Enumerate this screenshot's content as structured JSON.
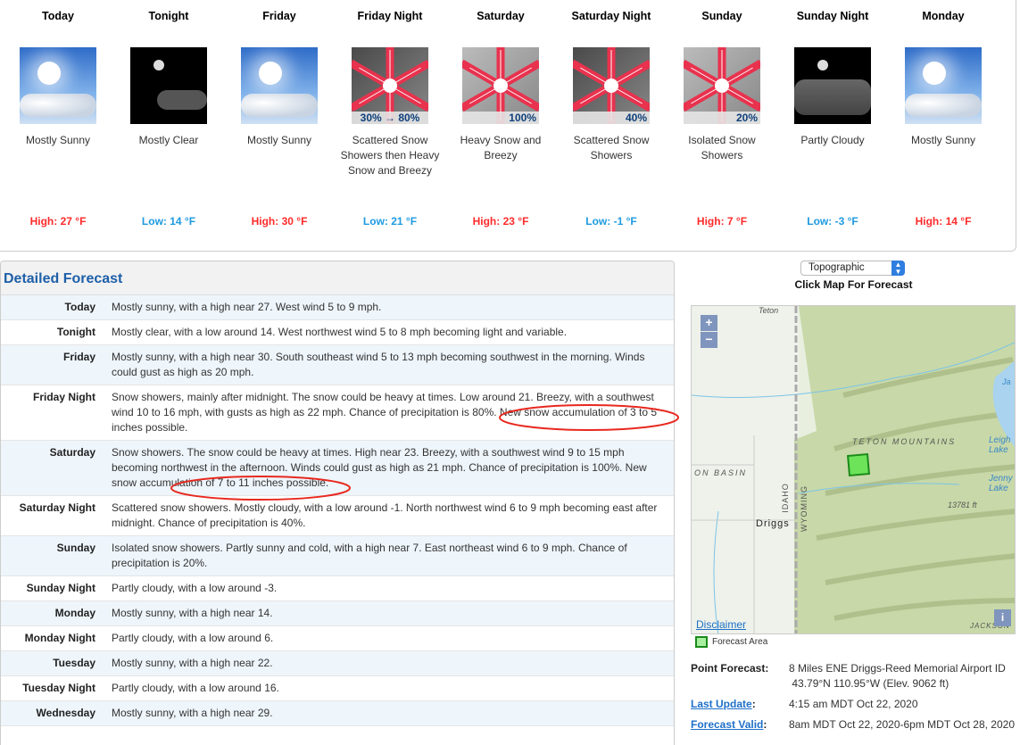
{
  "periods": [
    {
      "name": "Today",
      "icon": "sunny",
      "desc": "Mostly Sunny",
      "temp": "High: 27 °F",
      "kind": "hi"
    },
    {
      "name": "Tonight",
      "icon": "clear-night",
      "desc": "Mostly Clear",
      "temp": "Low: 14 °F",
      "kind": "lo"
    },
    {
      "name": "Friday",
      "icon": "sunny",
      "desc": "Mostly Sunny",
      "temp": "High: 30 °F",
      "kind": "hi"
    },
    {
      "name": "Friday Night",
      "icon": "snow",
      "pop": "30% → 80%",
      "desc": "Scattered Snow Showers then Heavy Snow and Breezy",
      "temp": "Low: 21 °F",
      "kind": "lo"
    },
    {
      "name": "Saturday",
      "icon": "snow",
      "pop": "100%",
      "desc": "Heavy Snow and Breezy",
      "temp": "High: 23 °F",
      "kind": "hi"
    },
    {
      "name": "Saturday Night",
      "icon": "snow",
      "pop": "40%",
      "desc": "Scattered Snow Showers",
      "temp": "Low: -1 °F",
      "kind": "lo"
    },
    {
      "name": "Sunday",
      "icon": "snow",
      "pop": "20%",
      "desc": "Isolated Snow Showers",
      "temp": "High: 7 °F",
      "kind": "hi"
    },
    {
      "name": "Sunday Night",
      "icon": "partly-cloudy-night",
      "desc": "Partly Cloudy",
      "temp": "Low: -3 °F",
      "kind": "lo"
    },
    {
      "name": "Monday",
      "icon": "sunny",
      "desc": "Mostly Sunny",
      "temp": "High: 14 °F",
      "kind": "hi"
    }
  ],
  "detailed": {
    "title": "Detailed Forecast",
    "rows": [
      {
        "label": "Today",
        "text": "Mostly sunny, with a high near 27. West wind 5 to 9 mph."
      },
      {
        "label": "Tonight",
        "text": "Mostly clear, with a low around 14. West northwest wind 5 to 8 mph becoming light and variable."
      },
      {
        "label": "Friday",
        "text": "Mostly sunny, with a high near 30. South southeast wind 5 to 13 mph becoming southwest in the morning. Winds could gust as high as 20 mph."
      },
      {
        "label": "Friday Night",
        "text": "Snow showers, mainly after midnight. The snow could be heavy at times. Low around 21. Breezy, with a southwest wind 10 to 16 mph, with gusts as high as 22 mph. Chance of precipitation is 80%. New snow accumulation of 3 to 5 inches possible."
      },
      {
        "label": "Saturday",
        "text": "Snow showers. The snow could be heavy at times. High near 23. Breezy, with a southwest wind 9 to 15 mph becoming northwest in the afternoon. Winds could gust as high as 21 mph. Chance of precipitation is 100%. New snow accumulation of 7 to 11 inches possible."
      },
      {
        "label": "Saturday Night",
        "text": "Scattered snow showers. Mostly cloudy, with a low around -1. North northwest wind 6 to 9 mph becoming east after midnight. Chance of precipitation is 40%."
      },
      {
        "label": "Sunday",
        "text": "Isolated snow showers. Partly sunny and cold, with a high near 7. East northeast wind 6 to 9 mph. Chance of precipitation is 20%."
      },
      {
        "label": "Sunday Night",
        "text": "Partly cloudy, with a low around -3."
      },
      {
        "label": "Monday",
        "text": "Mostly sunny, with a high near 14."
      },
      {
        "label": "Monday Night",
        "text": "Partly cloudy, with a low around 6."
      },
      {
        "label": "Tuesday",
        "text": "Mostly sunny, with a high near 22."
      },
      {
        "label": "Tuesday Night",
        "text": "Partly cloudy, with a low around 16."
      },
      {
        "label": "Wednesday",
        "text": "Mostly sunny, with a high near 29."
      }
    ]
  },
  "map": {
    "select": "Topographic",
    "click_label": "Click Map For Forecast",
    "zoom_in": "+",
    "zoom_out": "−",
    "disclaimer": "Disclaimer",
    "info": "i",
    "legend": "Forecast Area",
    "labels": {
      "teton": "Teton",
      "mountains": "TETON MOUNTAINS",
      "basin": "ON BASIN",
      "idaho": "IDAHO",
      "wyoming": "WYOMING",
      "driggs": "Driggs",
      "leigh": "Leigh Lake",
      "jenny": "Jenny Lake",
      "peak": "13781 ft",
      "ja": "Ja",
      "jackson": "JACKSON"
    }
  },
  "point": {
    "point_label": "Point Forecast:",
    "point_value": "8 Miles ENE Driggs-Reed Memorial Airport ID",
    "coords": "43.79°N 110.95°W (Elev. 9062 ft)",
    "update_label": "Last Update",
    "update_value": "4:15 am MDT Oct 22, 2020",
    "valid_label": "Forecast Valid",
    "valid_value": "8am MDT Oct 22, 2020-6pm MDT Oct 28, 2020"
  },
  "colors": {
    "high": "#ff2a2a",
    "low": "#1e9ae0",
    "link": "#1e70c8",
    "annotation": "#e8281e"
  }
}
